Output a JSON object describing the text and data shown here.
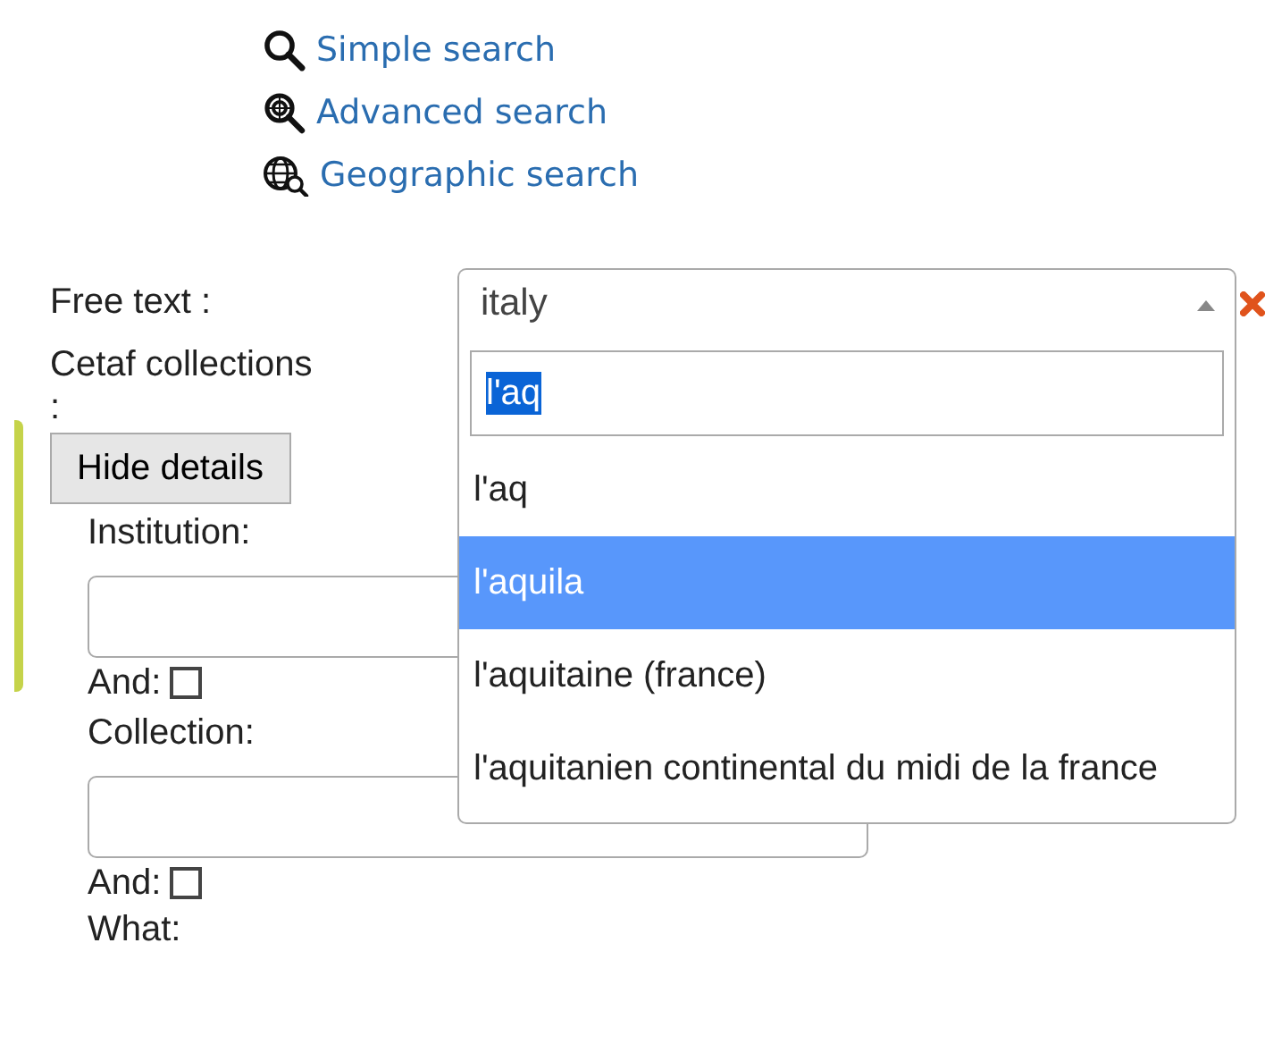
{
  "search_links": [
    {
      "kind": "simple",
      "label": "Simple search"
    },
    {
      "kind": "advanced",
      "label": "Advanced search"
    },
    {
      "kind": "geographic",
      "label": "Geographic search"
    }
  ],
  "free_text": {
    "label": "Free text :",
    "value": "italy",
    "expanded": true,
    "dropdown": {
      "search_value": "l'aq",
      "options": [
        {
          "label": "l'aq",
          "selected": false
        },
        {
          "label": "l'aquila",
          "selected": true
        },
        {
          "label": "l'aquitaine (france)",
          "selected": false
        },
        {
          "label": "l'aquitanien continental du midi de la france",
          "selected": false
        }
      ]
    }
  },
  "collections_label": "Cetaf collections",
  "collections_colon": ":",
  "details_button": "Hide details",
  "fields": [
    {
      "label": "Institution:",
      "and_label": "And:",
      "and_checked": false
    },
    {
      "label": "Collection:",
      "and_label": "And:",
      "and_checked": false
    }
  ],
  "next_label": "What:"
}
